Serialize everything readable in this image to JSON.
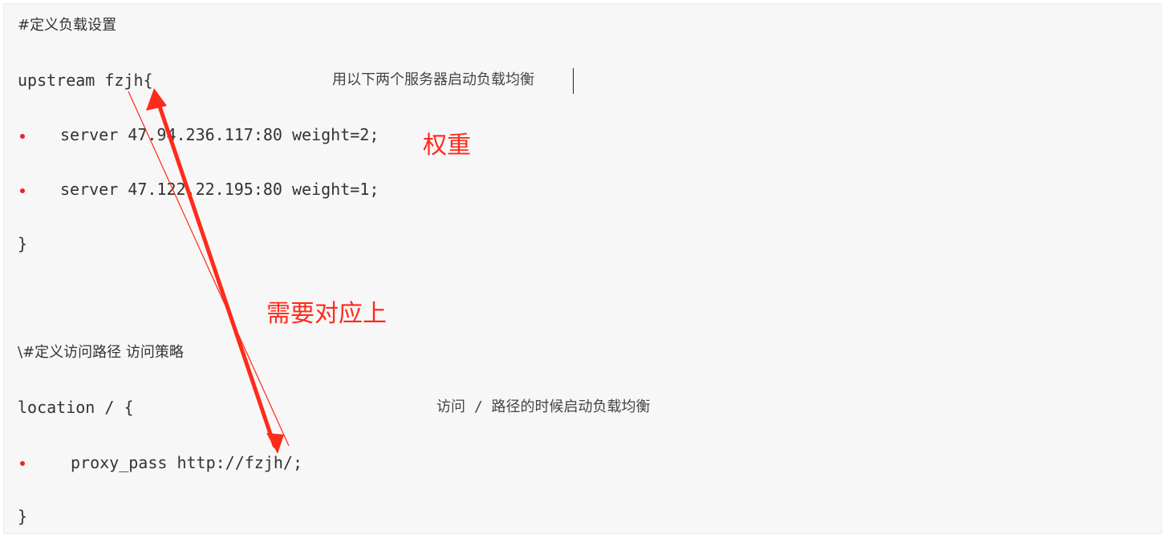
{
  "code": {
    "line1": "#定义负载设置",
    "line2": "upstream fzjh{",
    "line3": "server 47.94.236.117:80 weight=2;",
    "line4": "server 47.122.22.195:80 weight=1;",
    "line5": "}",
    "line6": "\\#定义访问路径 访问策略",
    "line7": "location / {",
    "line8": "proxy_pass http://fzjh/;",
    "line9": "}"
  },
  "comments": {
    "upstream_comment": "用以下两个服务器启动负载均衡",
    "location_comment": "访问 / 路径的时候启动负载均衡"
  },
  "annotations": {
    "weight_note": "权重",
    "match_note": "需要对应上"
  },
  "colors": {
    "annotation": "#ff2a1a",
    "bullet": "#e3262b",
    "panel_bg": "#f7f7f7"
  }
}
